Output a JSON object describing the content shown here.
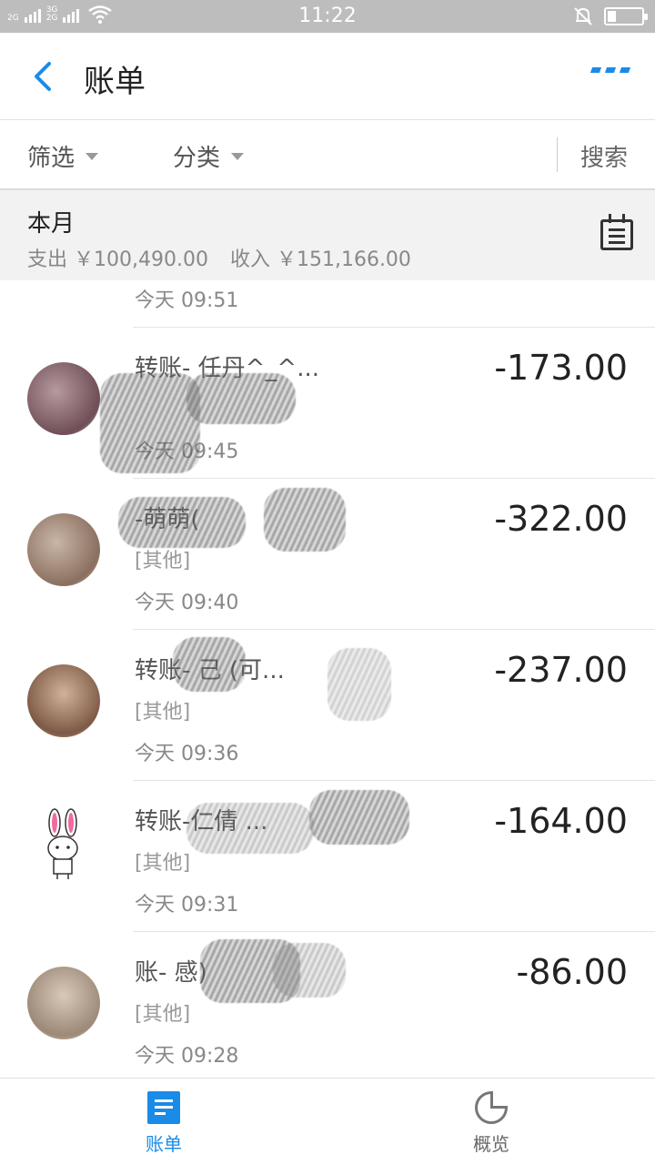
{
  "status_bar": {
    "sim1": "2G",
    "sim2_top": "3G",
    "sim2_bottom": "2G",
    "time": "11:22",
    "battery_level": 0.25,
    "icons": [
      "signal-icon",
      "wifi-icon",
      "mute-bell-icon",
      "battery-icon"
    ]
  },
  "header": {
    "title": "账单",
    "back_icon": "back-chevron-icon",
    "more_icon": "more-dots-icon",
    "accent_color": "#1a8be6"
  },
  "filters": {
    "filter_label": "筛选",
    "category_label": "分类",
    "search_label": "搜索"
  },
  "month": {
    "title": "本月",
    "expense": "支出 ￥100,490.00",
    "income": "收入 ￥151,166.00",
    "calendar_icon": "calendar-icon"
  },
  "transactions": [
    {
      "name": "",
      "category": "",
      "time": "今天  09:51",
      "amount": ""
    },
    {
      "name": "转账-    任丹^_^...",
      "category": "",
      "time": "今天  09:45",
      "amount": "-173.00"
    },
    {
      "name": "   -萌萌(",
      "category": "[其他]",
      "time": "今天  09:40",
      "amount": "-322.00"
    },
    {
      "name": "转账-       己    (可...",
      "category": "[其他]",
      "time": "今天  09:36",
      "amount": "-237.00"
    },
    {
      "name": "转账-仁倩         ...",
      "category": "[其他]",
      "time": "今天  09:31",
      "amount": "-164.00"
    },
    {
      "name": "  账-        感)",
      "category": "[其他]",
      "time": "今天  09:28",
      "amount": "-86.00"
    }
  ],
  "bottom_nav": {
    "bill_label": "账单",
    "overview_label": "概览"
  }
}
